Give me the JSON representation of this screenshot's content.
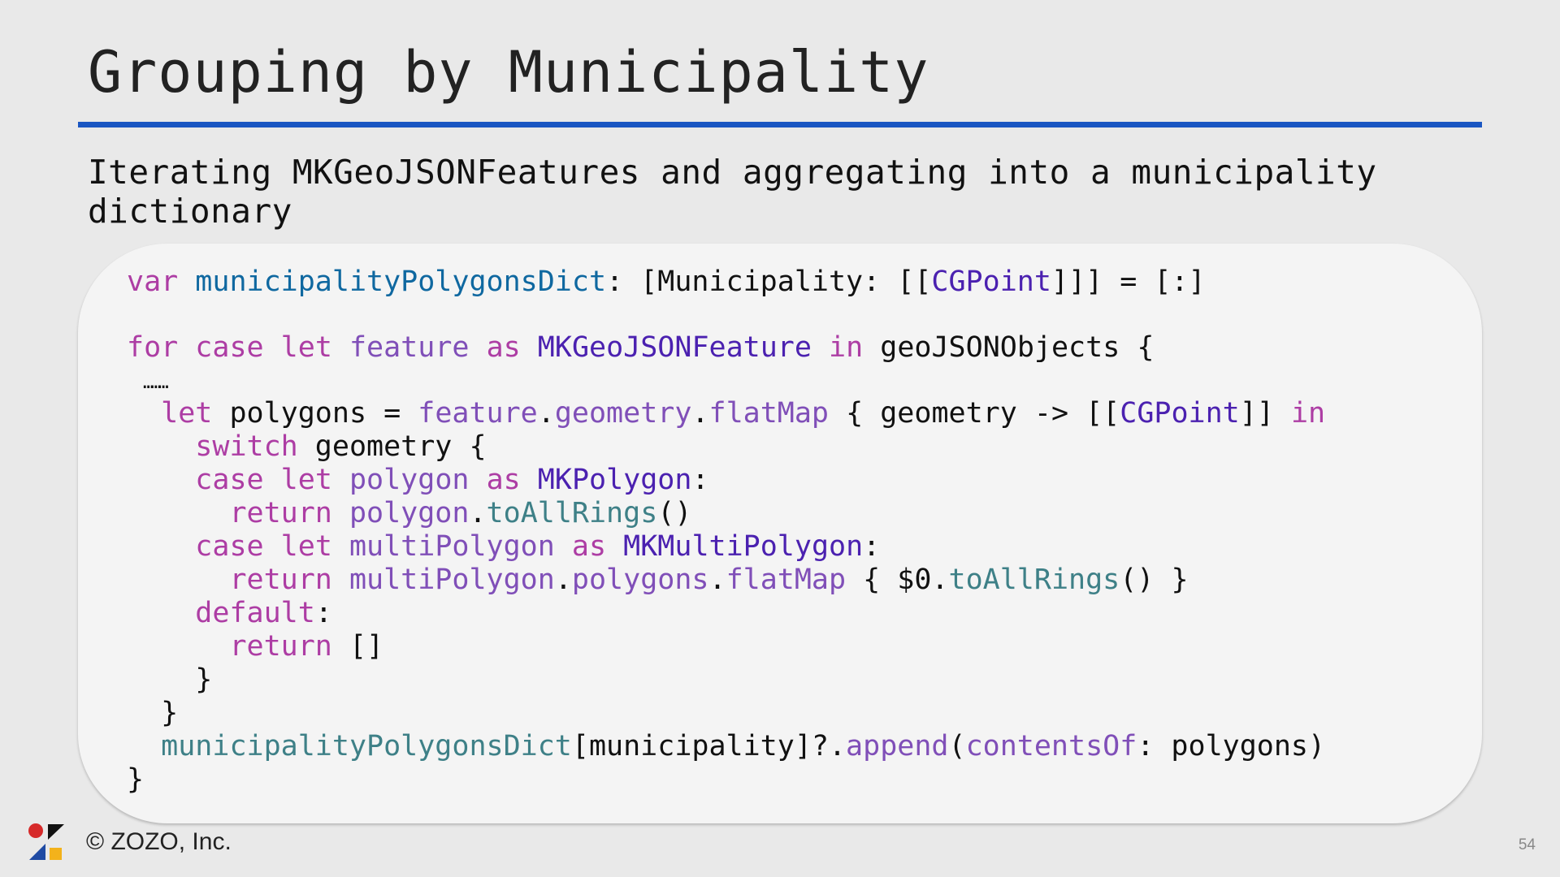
{
  "slide": {
    "title": "Grouping by Municipality",
    "subtitle": "Iterating MKGeoJSONFeatures and aggregating into a municipality dictionary",
    "footer": "© ZOZO, Inc.",
    "page_number": "54",
    "accent_color": "#1a56c2"
  },
  "code": {
    "l1": [
      "var",
      "municipalityPolygonsDict",
      ": [Municipality: [[",
      "CGPoint",
      "]]] = [:]"
    ],
    "l2": [
      "for",
      "case",
      "let",
      "feature",
      "as",
      "MKGeoJSONFeature",
      "in",
      "geoJSONObjects {"
    ],
    "dots": "………",
    "l3": [
      "let",
      " polygons = ",
      "feature",
      ".",
      "geometry",
      ".",
      "flatMap",
      " { geometry -> [[",
      "CGPoint",
      "]] ",
      "in"
    ],
    "l4": [
      "switch",
      " geometry {"
    ],
    "l5": [
      "case",
      "let",
      "polygon",
      "as",
      "MKPolygon",
      ":"
    ],
    "l6": [
      "return",
      "polygon",
      ".",
      "toAllRings",
      "()"
    ],
    "l7": [
      "case",
      "let",
      "multiPolygon",
      "as",
      "MKMultiPolygon",
      ":"
    ],
    "l8": [
      "return",
      "multiPolygon",
      ".",
      "polygons",
      ".",
      "flatMap",
      " { $0.",
      "toAllRings",
      "() }"
    ],
    "l9": [
      "default",
      ":"
    ],
    "l10": [
      "return",
      " []"
    ],
    "l11": "}",
    "l12": "}",
    "l13": [
      "municipalityPolygonsDict",
      "[municipality]?.",
      "append",
      "(",
      "contentsOf",
      ": polygons)"
    ],
    "l14": "}"
  }
}
